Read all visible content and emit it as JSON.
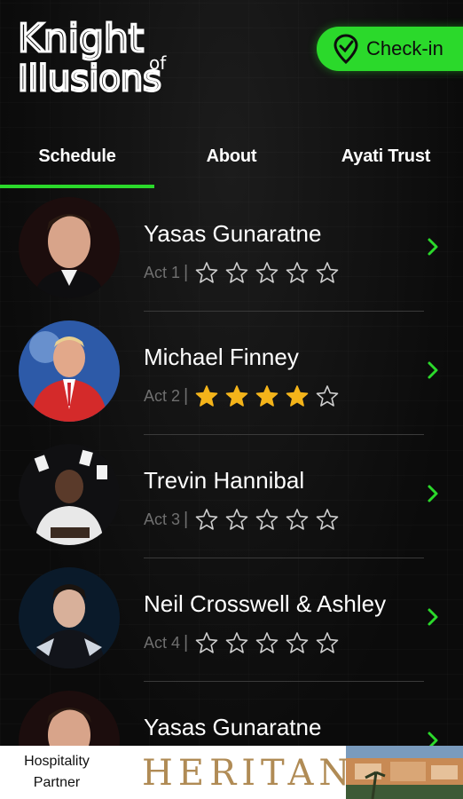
{
  "header": {
    "logo_text": {
      "line1": "Knight",
      "of": "of",
      "line2": "Illusions"
    },
    "checkin_label": "Check-in"
  },
  "tabs": [
    {
      "label": "Schedule",
      "active": true
    },
    {
      "label": "About",
      "active": false
    },
    {
      "label": "Ayati Trust",
      "active": false
    }
  ],
  "performers": [
    {
      "name": "Yasas Gunaratne",
      "act": "Act 1",
      "rating": 0,
      "max_rating": 5,
      "avatar": "man-in-tuxedo-portrait"
    },
    {
      "name": "Michael Finney",
      "act": "Act 2",
      "rating": 4,
      "max_rating": 5,
      "avatar": "man-in-red-suit-portrait"
    },
    {
      "name": "Trevin Hannibal",
      "act": "Act 3",
      "rating": 0,
      "max_rating": 5,
      "avatar": "man-with-flying-cards-portrait"
    },
    {
      "name": "Neil Crosswell & Ashley",
      "act": "Act 4",
      "rating": 0,
      "max_rating": 5,
      "avatar": "man-in-dark-portrait"
    },
    {
      "name": "Yasas Gunaratne",
      "act": "",
      "rating": 0,
      "max_rating": 5,
      "avatar": "man-in-tuxedo-portrait"
    }
  ],
  "footer": {
    "partner_label_line1": "Hospitality",
    "partner_label_line2": "Partner",
    "partner_name": "HERITANCE"
  },
  "colors": {
    "accent": "#2bd92b",
    "star_filled": "#f4b41a",
    "background": "#0a0a0a",
    "muted_text": "#6f6f6f"
  }
}
